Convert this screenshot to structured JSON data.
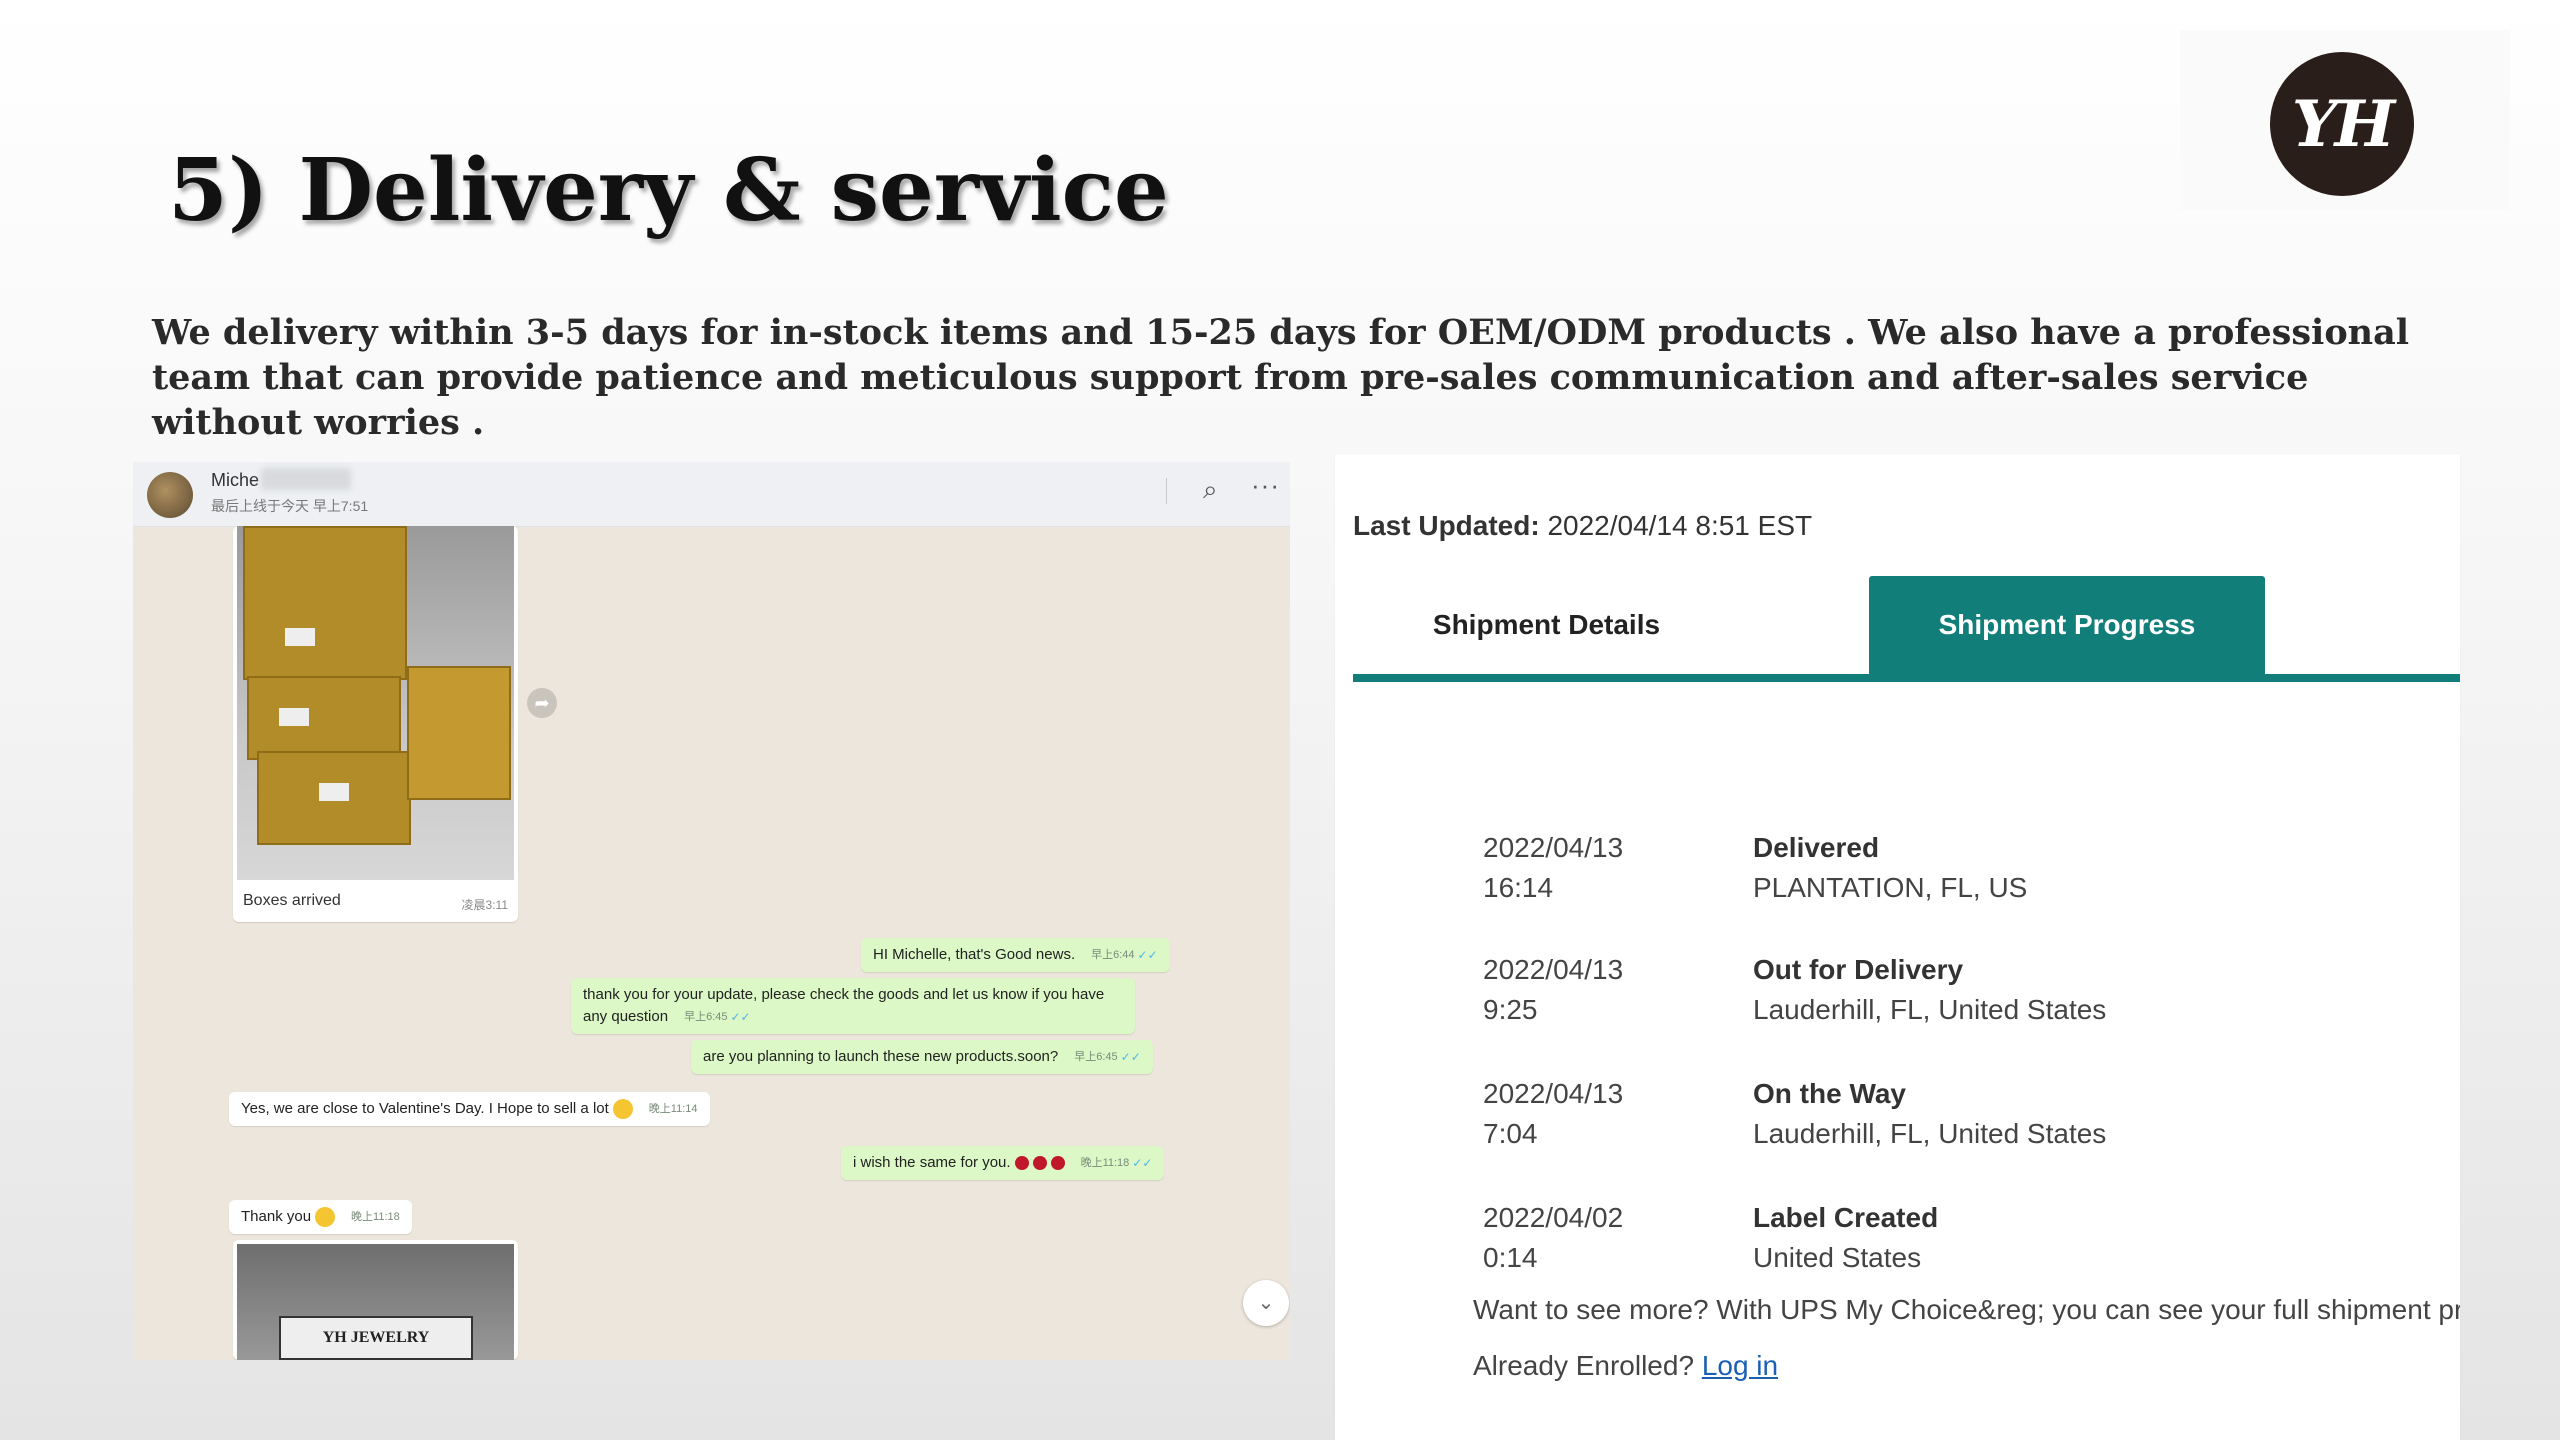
{
  "slide": {
    "title": "5) Delivery & service",
    "logo_text": "YH",
    "description": "We delivery within 3-5 days for in-stock items and 15-25 days for OEM/ODM products . We also have a professional team that can provide patience and meticulous support from pre-sales communication and after-sales service without worries ."
  },
  "chat": {
    "contact_name": "Miche",
    "contact_status": "最后上线于今天 早上7:51",
    "icons": [
      "search-icon",
      "more-icon",
      "forward-icon",
      "chevron-down-icon"
    ],
    "image_message": {
      "caption": "Boxes arrived",
      "time": "凌晨3:11"
    },
    "messages": [
      {
        "dir": "out",
        "text": "HI Michelle, that's Good news.",
        "time": "早上6:44"
      },
      {
        "dir": "out",
        "text": "thank you for your update, please check the goods and let us know if you have any question",
        "time": "早上6:45"
      },
      {
        "dir": "out",
        "text": "are you planning to launch these new products.soon?",
        "time": "早上6:45"
      },
      {
        "dir": "in",
        "text": "Yes, we are close to Valentine's Day. I Hope to sell a lot",
        "time": "晚上11:14"
      },
      {
        "dir": "out",
        "text": "i wish the same for you.",
        "time": "晚上11:18"
      },
      {
        "dir": "in",
        "text": "Thank you",
        "time": "晚上11:18"
      }
    ],
    "package_label": "YH JEWELRY"
  },
  "tracking": {
    "last_updated_label": "Last Updated:",
    "last_updated_value": "2022/04/14 8:51 EST",
    "tabs": [
      "Shipment Details",
      "Shipment Progress"
    ],
    "active_tab": "Shipment Progress",
    "accent_color": "#127e7a",
    "events": [
      {
        "date": "2022/04/13",
        "time": "16:14",
        "status": "Delivered",
        "location": "PLANTATION, FL, US"
      },
      {
        "date": "2022/04/13",
        "time": "9:25",
        "status": "Out for Delivery",
        "location": "Lauderhill, FL, United States"
      },
      {
        "date": "2022/04/13",
        "time": "7:04",
        "status": "On the Way",
        "location": "Lauderhill, FL, United States"
      },
      {
        "date": "2022/04/02",
        "time": "0:14",
        "status": "Label Created",
        "location": "United States"
      }
    ],
    "more_text": "Want to see more? With UPS My Choice&reg; you can see your full shipment pro",
    "enrolled_prompt": "Already Enrolled?",
    "login_link": "Log in"
  }
}
